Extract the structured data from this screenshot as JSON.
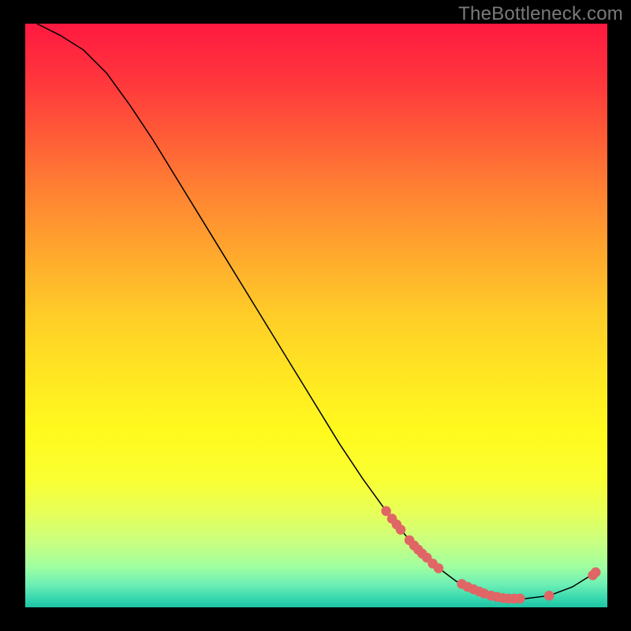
{
  "watermark": "TheBottleneck.com",
  "chart_data": {
    "type": "line",
    "title": "",
    "xlabel": "",
    "ylabel": "",
    "xlim": [
      0,
      100
    ],
    "ylim": [
      0,
      100
    ],
    "curve": [
      {
        "x": 2.0,
        "y": 100.0
      },
      {
        "x": 6.0,
        "y": 98.0
      },
      {
        "x": 10.0,
        "y": 95.5
      },
      {
        "x": 14.0,
        "y": 91.5
      },
      {
        "x": 18.0,
        "y": 86.0
      },
      {
        "x": 22.0,
        "y": 80.0
      },
      {
        "x": 26.0,
        "y": 73.5
      },
      {
        "x": 30.0,
        "y": 67.0
      },
      {
        "x": 34.0,
        "y": 60.5
      },
      {
        "x": 38.0,
        "y": 54.0
      },
      {
        "x": 42.0,
        "y": 47.5
      },
      {
        "x": 46.0,
        "y": 41.0
      },
      {
        "x": 50.0,
        "y": 34.5
      },
      {
        "x": 54.0,
        "y": 28.0
      },
      {
        "x": 58.0,
        "y": 22.0
      },
      {
        "x": 62.0,
        "y": 16.5
      },
      {
        "x": 66.0,
        "y": 11.5
      },
      {
        "x": 70.0,
        "y": 7.5
      },
      {
        "x": 74.0,
        "y": 4.5
      },
      {
        "x": 78.0,
        "y": 2.5
      },
      {
        "x": 82.0,
        "y": 1.5
      },
      {
        "x": 86.0,
        "y": 1.5
      },
      {
        "x": 90.0,
        "y": 2.0
      },
      {
        "x": 94.0,
        "y": 3.5
      },
      {
        "x": 98.0,
        "y": 6.0
      }
    ],
    "markers": [
      {
        "x": 62.0,
        "y": 16.5
      },
      {
        "x": 63.0,
        "y": 15.2
      },
      {
        "x": 63.8,
        "y": 14.2
      },
      {
        "x": 64.5,
        "y": 13.3
      },
      {
        "x": 66.0,
        "y": 11.5
      },
      {
        "x": 66.8,
        "y": 10.6
      },
      {
        "x": 67.5,
        "y": 9.9
      },
      {
        "x": 68.2,
        "y": 9.2
      },
      {
        "x": 69.0,
        "y": 8.5
      },
      {
        "x": 70.0,
        "y": 7.5
      },
      {
        "x": 71.0,
        "y": 6.7
      },
      {
        "x": 75.0,
        "y": 4.0
      },
      {
        "x": 76.0,
        "y": 3.5
      },
      {
        "x": 77.0,
        "y": 3.1
      },
      {
        "x": 78.0,
        "y": 2.7
      },
      {
        "x": 78.8,
        "y": 2.4
      },
      {
        "x": 80.0,
        "y": 2.0
      },
      {
        "x": 81.0,
        "y": 1.8
      },
      {
        "x": 82.0,
        "y": 1.6
      },
      {
        "x": 83.0,
        "y": 1.5
      },
      {
        "x": 84.0,
        "y": 1.5
      },
      {
        "x": 85.0,
        "y": 1.5
      },
      {
        "x": 90.0,
        "y": 2.0
      },
      {
        "x": 97.5,
        "y": 5.5
      },
      {
        "x": 98.0,
        "y": 6.0
      }
    ],
    "gradient_bands": [
      {
        "offset": 0.0,
        "color": "rgb(255, 25, 65)"
      },
      {
        "offset": 0.1,
        "color": "rgb(255, 55, 60)"
      },
      {
        "offset": 0.2,
        "color": "rgb(255, 95, 55)"
      },
      {
        "offset": 0.3,
        "color": "rgb(255, 135, 50)"
      },
      {
        "offset": 0.4,
        "color": "rgb(255, 170, 45)"
      },
      {
        "offset": 0.5,
        "color": "rgb(255, 205, 40)"
      },
      {
        "offset": 0.6,
        "color": "rgb(255, 230, 35)"
      },
      {
        "offset": 0.7,
        "color": "rgb(255, 250, 30)"
      },
      {
        "offset": 0.78,
        "color": "rgb(250, 255, 50)"
      },
      {
        "offset": 0.84,
        "color": "rgb(230, 255, 90)"
      },
      {
        "offset": 0.89,
        "color": "rgb(200, 255, 130)"
      },
      {
        "offset": 0.93,
        "color": "rgb(160, 255, 160)"
      },
      {
        "offset": 0.96,
        "color": "rgb(110, 240, 180)"
      },
      {
        "offset": 0.985,
        "color": "rgb(55, 215, 175)"
      },
      {
        "offset": 1.0,
        "color": "rgb(30, 195, 165)"
      }
    ],
    "marker_color": "#e06666",
    "curve_color": "#000000"
  }
}
